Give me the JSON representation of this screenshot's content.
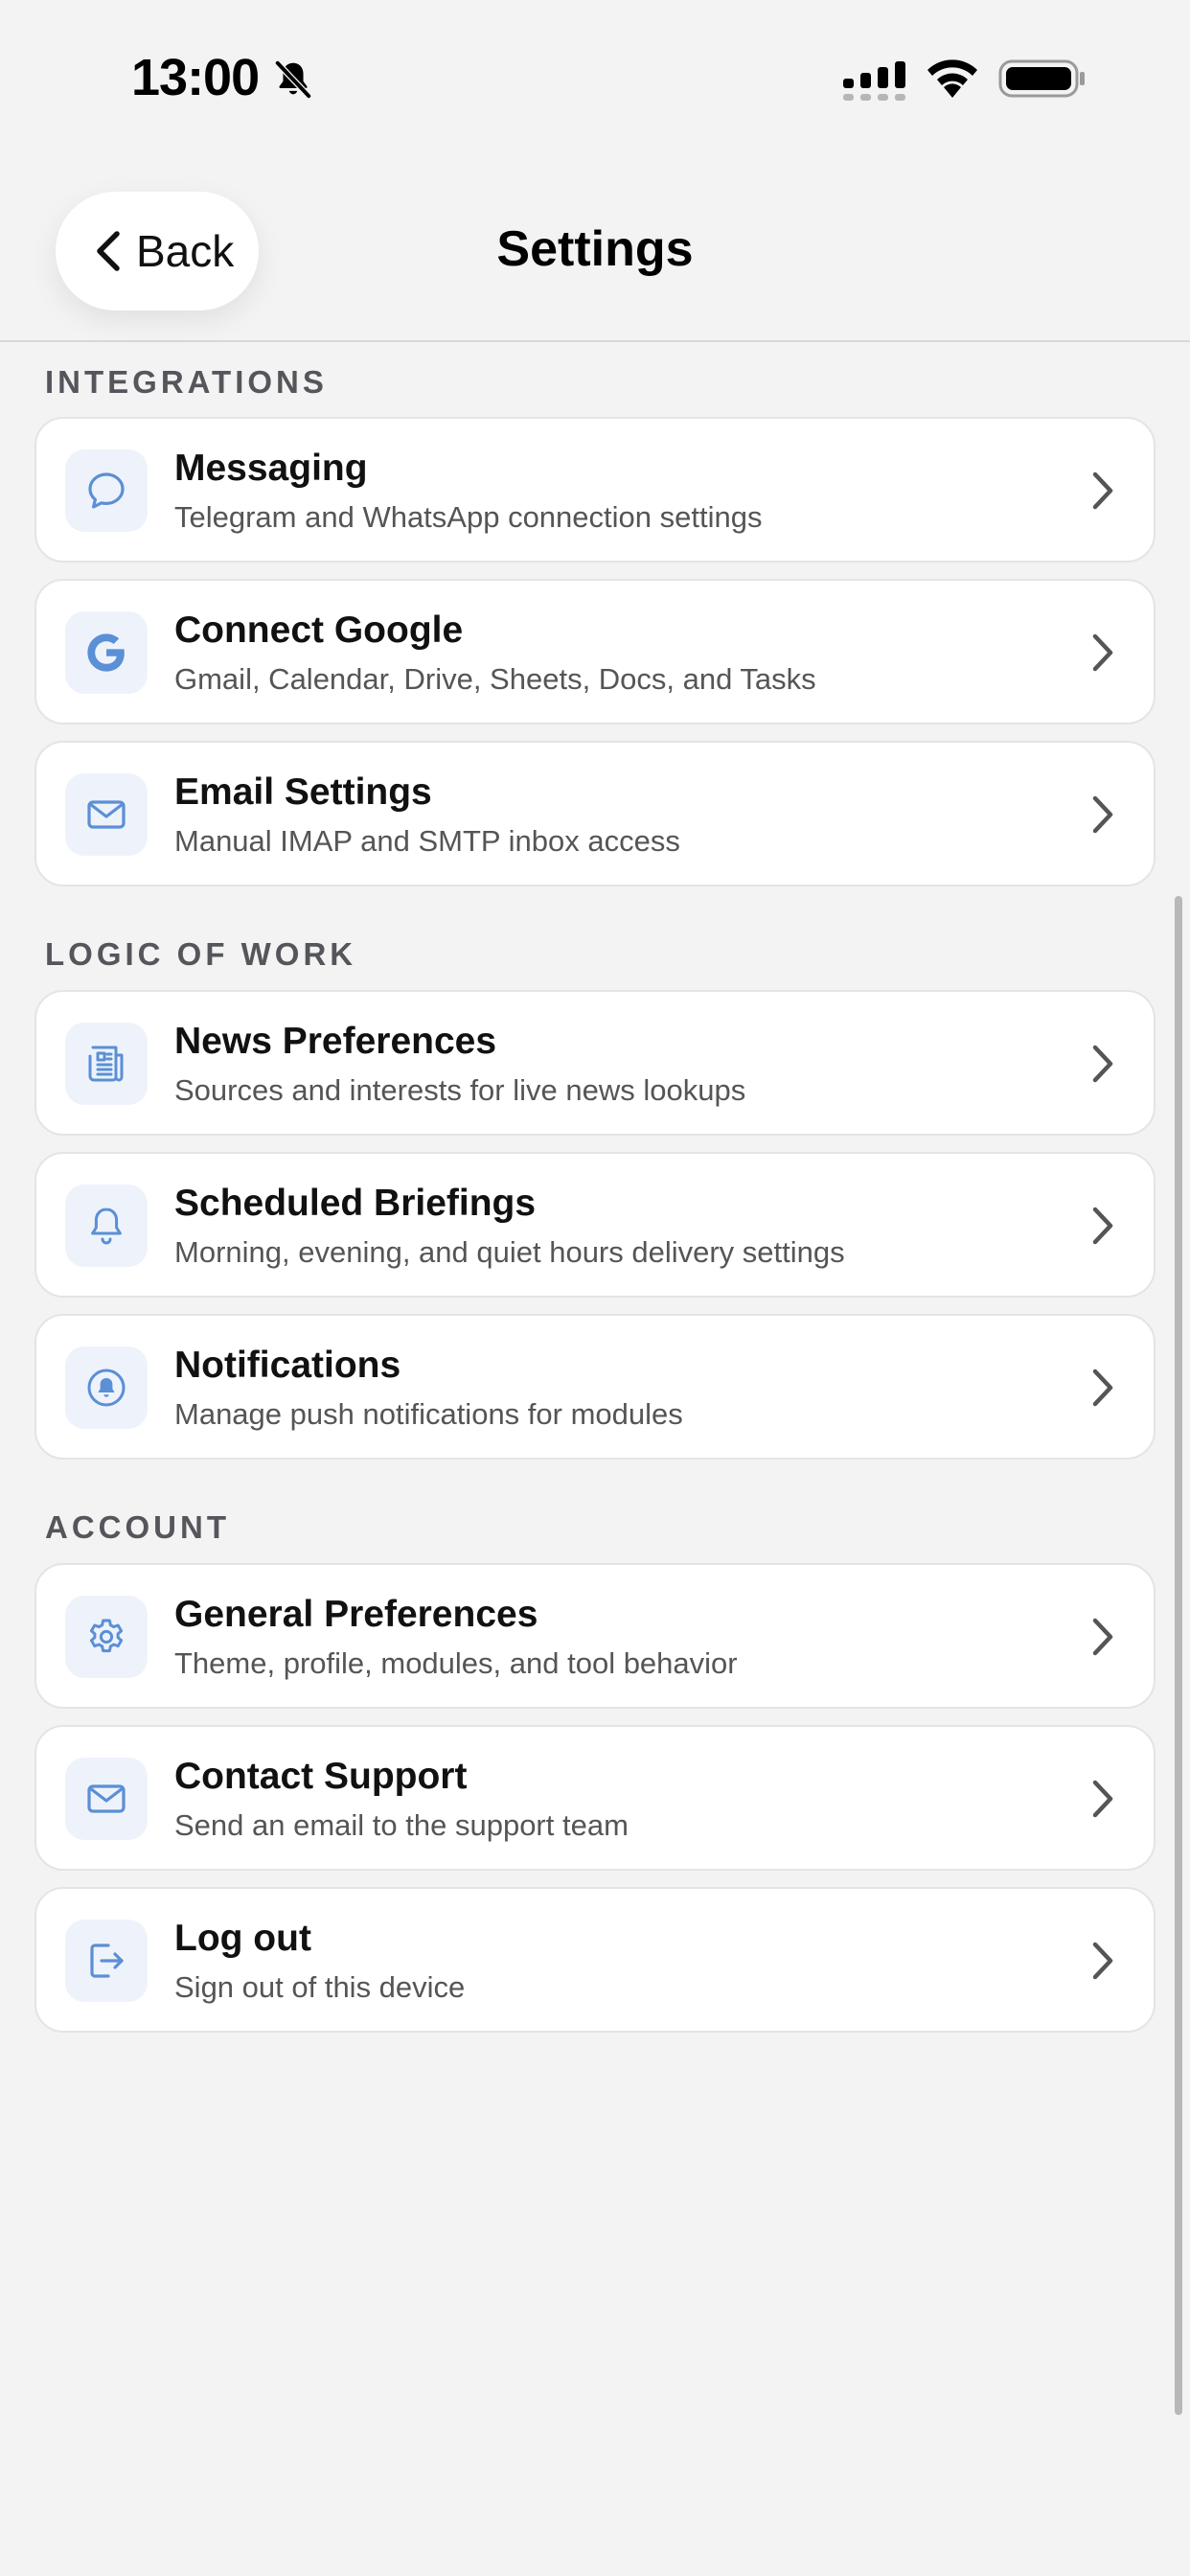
{
  "status_bar": {
    "time": "13:00"
  },
  "nav": {
    "back_label": "Back",
    "title": "Settings"
  },
  "sections": {
    "integrations": {
      "title": "INTEGRATIONS",
      "items": [
        {
          "title": "Messaging",
          "subtitle": "Telegram and WhatsApp connection settings",
          "icon": "chat-bubble-icon"
        },
        {
          "title": "Connect Google",
          "subtitle": "Gmail, Calendar, Drive, Sheets, Docs, and Tasks",
          "icon": "google-g-icon"
        },
        {
          "title": "Email Settings",
          "subtitle": "Manual IMAP and SMTP inbox access",
          "icon": "envelope-icon"
        }
      ]
    },
    "logic": {
      "title": "LOGIC OF WORK",
      "items": [
        {
          "title": "News Preferences",
          "subtitle": "Sources and interests for live news lookups",
          "icon": "newspaper-icon"
        },
        {
          "title": "Scheduled Briefings",
          "subtitle": "Morning, evening, and quiet hours delivery settings",
          "icon": "bell-icon"
        },
        {
          "title": "Notifications",
          "subtitle": "Manage push notifications for modules",
          "icon": "notification-bell-icon"
        }
      ]
    },
    "account": {
      "title": "ACCOUNT",
      "items": [
        {
          "title": "General Preferences",
          "subtitle": "Theme, profile, modules, and tool behavior",
          "icon": "gear-icon"
        },
        {
          "title": "Contact Support",
          "subtitle": "Send an email to the support team",
          "icon": "envelope-icon"
        },
        {
          "title": "Log out",
          "subtitle": "Sign out of this device",
          "icon": "logout-icon"
        }
      ]
    }
  },
  "colors": {
    "icon_blue": "#5b8fd6",
    "icon_bg": "#eef3fb",
    "background": "#f3f3f3"
  }
}
